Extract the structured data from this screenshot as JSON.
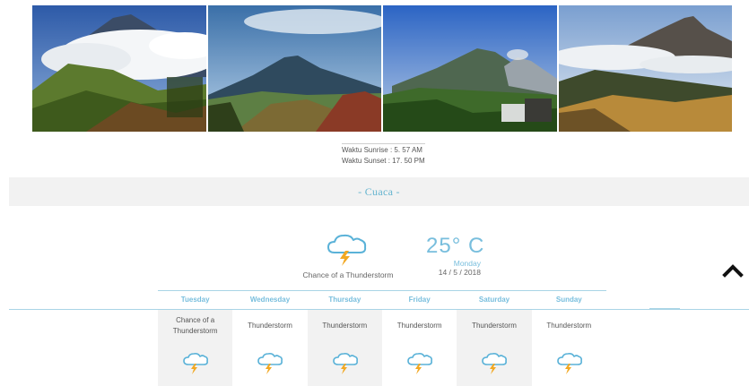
{
  "sun": {
    "sunrise": "Waktu Sunrise : 5. 57 AM",
    "sunset": "Waktu Sunset  : 17. 50 PM"
  },
  "section": {
    "title": "- Cuaca -"
  },
  "current": {
    "condition": "Chance of a Thunderstorm",
    "temperature": "25° C",
    "day": "Monday",
    "date": "14 / 5 / 2018",
    "icon": "thunderstorm-cloud-icon"
  },
  "forecast": {
    "days": [
      {
        "name": "Tuesday",
        "condition": "Chance of a Thunderstorm",
        "icon": "thunderstorm-cloud-icon"
      },
      {
        "name": "Wednesday",
        "condition": "Thunderstorm",
        "icon": "thunderstorm-cloud-icon"
      },
      {
        "name": "Thursday",
        "condition": "Thunderstorm",
        "icon": "thunderstorm-cloud-icon"
      },
      {
        "name": "Friday",
        "condition": "Thunderstorm",
        "icon": "thunderstorm-cloud-icon"
      },
      {
        "name": "Saturday",
        "condition": "Thunderstorm",
        "icon": "thunderstorm-cloud-icon"
      },
      {
        "name": "Sunday",
        "condition": "Thunderstorm",
        "icon": "thunderstorm-cloud-icon"
      }
    ]
  },
  "colors": {
    "accent": "#78bedd",
    "bolt": "#f2a822",
    "panel": "#f2f2f2"
  },
  "scroll_top_icon": "chevron-up-icon"
}
